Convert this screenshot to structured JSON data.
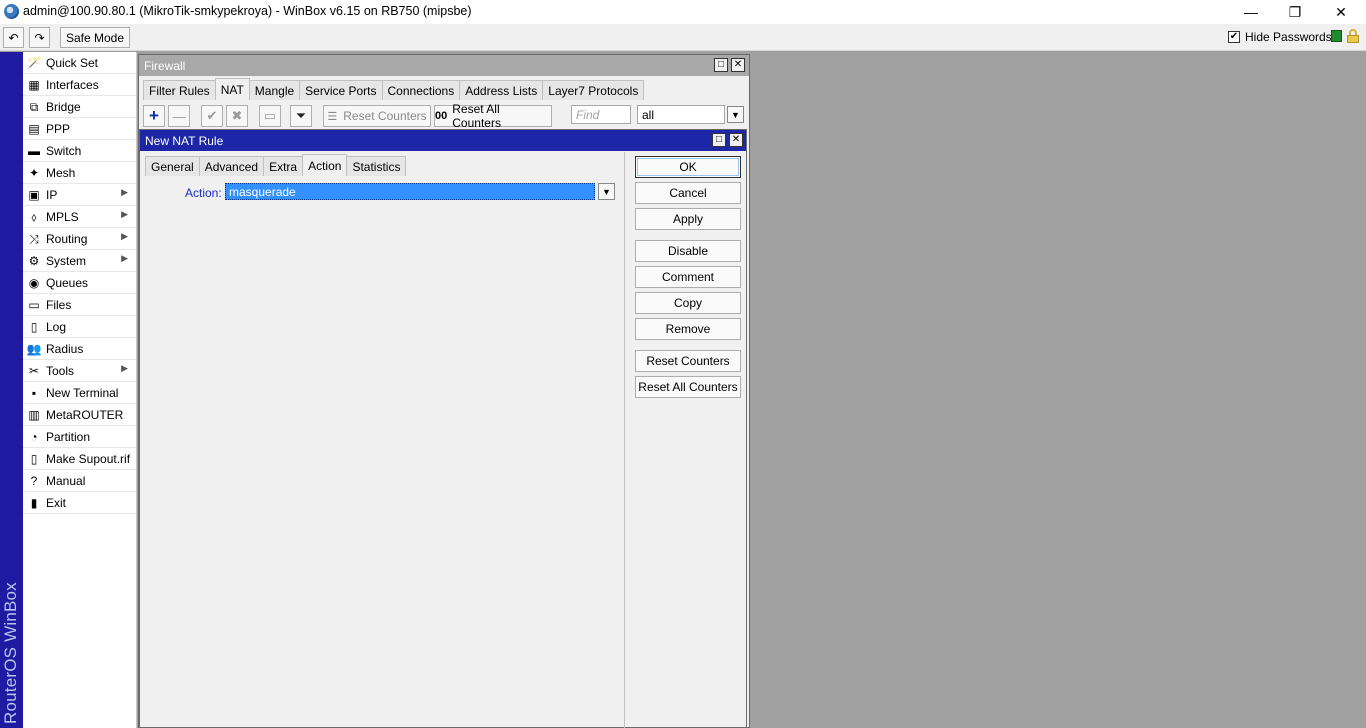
{
  "window": {
    "title": "admin@100.90.80.1 (MikroTik-smkypekroya) - WinBox v6.15 on RB750 (mipsbe)",
    "controls": {
      "minimize": "—",
      "restore": "❐",
      "close": "✕"
    }
  },
  "toolbar": {
    "undo_icon": "↶",
    "redo_icon": "↷",
    "safe_mode_label": "Safe Mode",
    "hide_passwords_label": "Hide Passwords",
    "hide_passwords_checked": "✔"
  },
  "brand_bar": {
    "text": "RouterOS WinBox"
  },
  "sidebar": {
    "items": [
      {
        "label": "Quick Set",
        "icon": "🪄"
      },
      {
        "label": "Interfaces",
        "icon": "▦"
      },
      {
        "label": "Bridge",
        "icon": "⧉"
      },
      {
        "label": "PPP",
        "icon": "▤"
      },
      {
        "label": "Switch",
        "icon": "▬"
      },
      {
        "label": "Mesh",
        "icon": "✦"
      },
      {
        "label": "IP",
        "icon": "▣",
        "arrow": "▶"
      },
      {
        "label": "MPLS",
        "icon": "⬨",
        "arrow": "▶"
      },
      {
        "label": "Routing",
        "icon": "⤨",
        "arrow": "▶"
      },
      {
        "label": "System",
        "icon": "⚙",
        "arrow": "▶"
      },
      {
        "label": "Queues",
        "icon": "◉"
      },
      {
        "label": "Files",
        "icon": "▭"
      },
      {
        "label": "Log",
        "icon": "▯"
      },
      {
        "label": "Radius",
        "icon": "👥"
      },
      {
        "label": "Tools",
        "icon": "✂",
        "arrow": "▶"
      },
      {
        "label": "New Terminal",
        "icon": "▪"
      },
      {
        "label": "MetaROUTER",
        "icon": "▥"
      },
      {
        "label": "Partition",
        "icon": "◔"
      },
      {
        "label": "Make Supout.rif",
        "icon": "▯"
      },
      {
        "label": "Manual",
        "icon": "?"
      },
      {
        "label": "Exit",
        "icon": "▮"
      }
    ]
  },
  "firewall": {
    "title": "Firewall",
    "tabs": [
      "Filter Rules",
      "NAT",
      "Mangle",
      "Service Ports",
      "Connections",
      "Address Lists",
      "Layer7 Protocols"
    ],
    "active_tab": "NAT",
    "toolbar": {
      "add_icon": "+",
      "remove_icon": "—",
      "enable_icon": "✔",
      "disable_icon": "✖",
      "comment_icon": "▭",
      "filter_icon": "⏷",
      "reset_counters_label": "Reset Counters",
      "reset_all_counters_label": "Reset All Counters",
      "reset_all_icon": "00",
      "find_placeholder": "Find",
      "filter_value": "all",
      "dropdown_icon": "▼"
    },
    "buttons": {
      "maximize": "□",
      "close": "✕"
    }
  },
  "nat_rule": {
    "title": "New NAT Rule",
    "tabs": [
      "General",
      "Advanced",
      "Extra",
      "Action",
      "Statistics"
    ],
    "active_tab": "Action",
    "action_label": "Action:",
    "action_value": "masquerade",
    "dropdown_icon": "▼",
    "buttons": {
      "ok": "OK",
      "cancel": "Cancel",
      "apply": "Apply",
      "disable": "Disable",
      "comment": "Comment",
      "copy": "Copy",
      "remove": "Remove",
      "reset_counters": "Reset Counters",
      "reset_all_counters": "Reset All Counters"
    },
    "window_buttons": {
      "maximize": "□",
      "close": "✕"
    }
  }
}
